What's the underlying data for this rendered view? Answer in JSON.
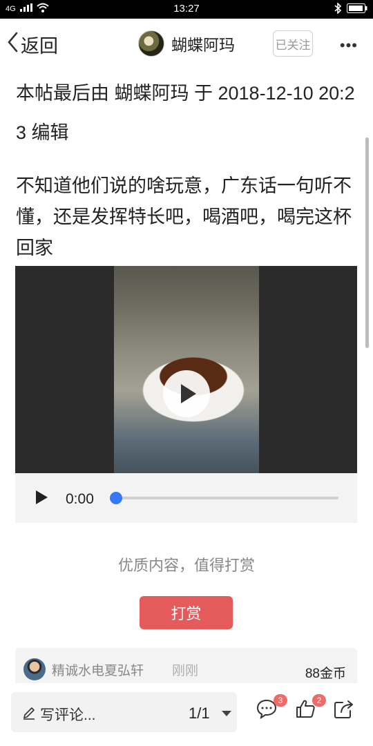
{
  "status_bar": {
    "signal": "4G",
    "time": "13:27"
  },
  "nav": {
    "back_label": "返回",
    "author_name": "蝴蝶阿玛",
    "follow_label": "已关注",
    "more_label": "•••"
  },
  "post": {
    "edit_note": "本帖最后由 蝴蝶阿玛 于 2018-12-10 20:23 编辑",
    "body": "不知道他们说的啥玩意，广东话一句听不懂，还是发挥特长吧，喝酒吧，喝完这杯回家"
  },
  "audio": {
    "current_time": "0:00",
    "progress": 0
  },
  "reward": {
    "hint": "优质内容，值得打赏",
    "button_label": "打赏",
    "record": {
      "user": "精诚水电夏弘轩",
      "time": "刚刚",
      "amount": "88金币"
    }
  },
  "bottom_bar": {
    "comment_placeholder": "写评论...",
    "page_indicator": "1/1",
    "comment_count": "3",
    "like_count": "2"
  },
  "colors": {
    "accent_red": "#e55b5b",
    "badge_red": "#f06a6a",
    "audio_blue": "#3478f6"
  },
  "icons": [
    "signal-icon",
    "wifi-icon",
    "bluetooth-icon",
    "battery-icon",
    "back-chevron-icon",
    "play-icon",
    "pencil-icon",
    "comment-icon",
    "like-icon",
    "share-icon"
  ]
}
